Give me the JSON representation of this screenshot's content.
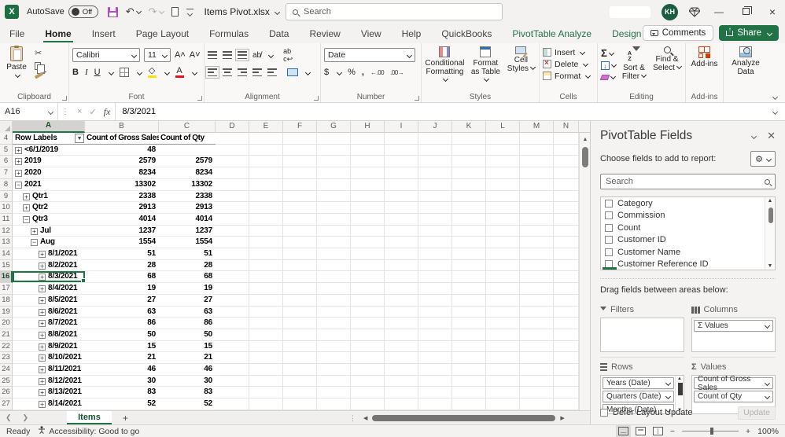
{
  "titlebar": {
    "autosave_label": "AutoSave",
    "autosave_state": "Off",
    "filename": "Items Pivot.xlsx",
    "search_placeholder": "Search",
    "avatar_initials": "KH"
  },
  "menu": {
    "tabs": [
      {
        "label": "File",
        "type": "normal"
      },
      {
        "label": "Home",
        "type": "active"
      },
      {
        "label": "Insert",
        "type": "normal"
      },
      {
        "label": "Page Layout",
        "type": "normal"
      },
      {
        "label": "Formulas",
        "type": "normal"
      },
      {
        "label": "Data",
        "type": "normal"
      },
      {
        "label": "Review",
        "type": "normal"
      },
      {
        "label": "View",
        "type": "normal"
      },
      {
        "label": "Help",
        "type": "normal"
      },
      {
        "label": "QuickBooks",
        "type": "normal"
      },
      {
        "label": "PivotTable Analyze",
        "type": "contextual"
      },
      {
        "label": "Design",
        "type": "contextual"
      }
    ],
    "comments_label": "Comments",
    "share_label": "Share"
  },
  "ribbon": {
    "clipboard": {
      "label": "Clipboard",
      "paste": "Paste"
    },
    "font": {
      "label": "Font",
      "font_name": "Calibri",
      "font_size": "11"
    },
    "alignment": {
      "label": "Alignment"
    },
    "number": {
      "label": "Number",
      "format": "Date"
    },
    "styles": {
      "label": "Styles",
      "buttons": [
        "Conditional Formatting",
        "Format as Table",
        "Cell Styles"
      ]
    },
    "cells": {
      "label": "Cells",
      "buttons": [
        "Insert",
        "Delete",
        "Format"
      ]
    },
    "editing": {
      "label": "Editing",
      "buttons": [
        "Sort & Filter",
        "Find & Select"
      ]
    },
    "addins": {
      "label": "Add-ins",
      "button": "Add-ins"
    },
    "analyze": {
      "button": "Analyze Data"
    }
  },
  "formula_bar": {
    "name_box": "A16",
    "value": "8/3/2021"
  },
  "grid": {
    "columns": [
      "A",
      "B",
      "C",
      "D",
      "E",
      "F",
      "G",
      "H",
      "I",
      "J",
      "K",
      "L",
      "M",
      "N"
    ],
    "header_row": {
      "n": 4,
      "a": "Row Labels",
      "b": "Count of Gross Sales",
      "c": "Count of Qty"
    },
    "rows": [
      {
        "n": 5,
        "label": "<6/1/2019",
        "exp": "+",
        "indent": 0,
        "b": "48",
        "c": ""
      },
      {
        "n": 6,
        "label": "2019",
        "exp": "+",
        "indent": 0,
        "b": "2579",
        "c": "2579"
      },
      {
        "n": 7,
        "label": "2020",
        "exp": "+",
        "indent": 0,
        "b": "8234",
        "c": "8234"
      },
      {
        "n": 8,
        "label": "2021",
        "exp": "-",
        "indent": 0,
        "b": "13302",
        "c": "13302"
      },
      {
        "n": 9,
        "label": "Qtr1",
        "exp": "+",
        "indent": 1,
        "b": "2338",
        "c": "2338"
      },
      {
        "n": 10,
        "label": "Qtr2",
        "exp": "+",
        "indent": 1,
        "b": "2913",
        "c": "2913"
      },
      {
        "n": 11,
        "label": "Qtr3",
        "exp": "-",
        "indent": 1,
        "b": "4014",
        "c": "4014"
      },
      {
        "n": 12,
        "label": "Jul",
        "exp": "+",
        "indent": 2,
        "b": "1237",
        "c": "1237"
      },
      {
        "n": 13,
        "label": "Aug",
        "exp": "-",
        "indent": 2,
        "b": "1554",
        "c": "1554"
      },
      {
        "n": 14,
        "label": "8/1/2021",
        "exp": "+",
        "indent": 3,
        "b": "51",
        "c": "51"
      },
      {
        "n": 15,
        "label": "8/2/2021",
        "exp": "+",
        "indent": 3,
        "b": "28",
        "c": "28"
      },
      {
        "n": 16,
        "label": "8/3/2021",
        "exp": "+",
        "indent": 3,
        "b": "68",
        "c": "68",
        "selected": true
      },
      {
        "n": 17,
        "label": "8/4/2021",
        "exp": "+",
        "indent": 3,
        "b": "19",
        "c": "19"
      },
      {
        "n": 18,
        "label": "8/5/2021",
        "exp": "+",
        "indent": 3,
        "b": "27",
        "c": "27"
      },
      {
        "n": 19,
        "label": "8/6/2021",
        "exp": "+",
        "indent": 3,
        "b": "63",
        "c": "63"
      },
      {
        "n": 20,
        "label": "8/7/2021",
        "exp": "+",
        "indent": 3,
        "b": "86",
        "c": "86"
      },
      {
        "n": 21,
        "label": "8/8/2021",
        "exp": "+",
        "indent": 3,
        "b": "50",
        "c": "50"
      },
      {
        "n": 22,
        "label": "8/9/2021",
        "exp": "+",
        "indent": 3,
        "b": "15",
        "c": "15"
      },
      {
        "n": 23,
        "label": "8/10/2021",
        "exp": "+",
        "indent": 3,
        "b": "21",
        "c": "21"
      },
      {
        "n": 24,
        "label": "8/11/2021",
        "exp": "+",
        "indent": 3,
        "b": "46",
        "c": "46"
      },
      {
        "n": 25,
        "label": "8/12/2021",
        "exp": "+",
        "indent": 3,
        "b": "30",
        "c": "30"
      },
      {
        "n": 26,
        "label": "8/13/2021",
        "exp": "+",
        "indent": 3,
        "b": "83",
        "c": "83"
      },
      {
        "n": 27,
        "label": "8/14/2021",
        "exp": "+",
        "indent": 3,
        "b": "52",
        "c": "52"
      }
    ]
  },
  "sheet_bar": {
    "tab": "Items"
  },
  "status_bar": {
    "ready": "Ready",
    "accessibility": "Accessibility: Good to go",
    "zoom": "100%"
  },
  "pane": {
    "title": "PivotTable Fields",
    "subtitle": "Choose fields to add to report:",
    "search_placeholder": "Search",
    "fields": [
      "Category",
      "Commission",
      "Count",
      "Customer ID",
      "Customer Name",
      "Customer Reference ID"
    ],
    "drag_hint": "Drag fields between areas below:",
    "areas": {
      "filters_label": "Filters",
      "columns_label": "Columns",
      "rows_label": "Rows",
      "values_label": "Values",
      "columns_items": [
        "Σ Values"
      ],
      "rows_items": [
        "Years (Date)",
        "Quarters (Date)",
        "Months (Date)"
      ],
      "values_items": [
        "Count of Gross Sales",
        "Count of Qty"
      ]
    },
    "defer_label": "Defer Layout Update",
    "update_label": "Update"
  },
  "colors": {
    "accent_green": "#217346",
    "save_icon": "#b14fc5",
    "addins_orange": "#d83b01"
  }
}
